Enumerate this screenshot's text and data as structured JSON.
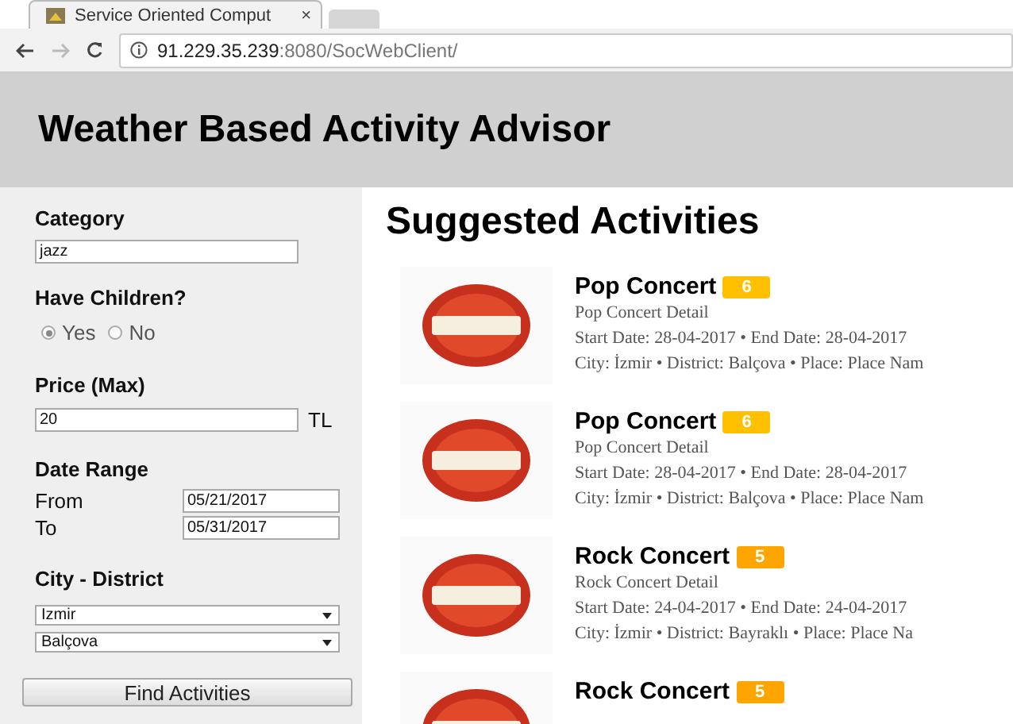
{
  "browser": {
    "tab_title": "Service Oriented Comput",
    "tab_close": "×",
    "url_host": "91.229.35.239",
    "url_rest": ":8080/SocWebClient/"
  },
  "header": {
    "title": "Weather Based Activity Advisor"
  },
  "sidebar": {
    "category_label": "Category",
    "category_value": "jazz",
    "children_label": "Have Children?",
    "children_options": [
      {
        "label": "Yes",
        "selected": true
      },
      {
        "label": "No",
        "selected": false
      }
    ],
    "price_label": "Price (Max)",
    "price_value": "20",
    "price_unit": "TL",
    "date_label": "Date Range",
    "from_label": "From",
    "from_value": "05/21/2017",
    "to_label": "To",
    "to_value": "05/31/2017",
    "city_label": "City - District",
    "city_value": "Izmir",
    "district_value": "Balçova",
    "button": "Find Activities"
  },
  "main": {
    "title": "Suggested Activities",
    "activities": [
      {
        "title": "Pop Concert",
        "score": "6",
        "color": "#ffc000",
        "detail": "Pop Concert Detail",
        "dates": "Start Date: 28-04-2017 • End Date: 28-04-2017",
        "place": "City: İzmir • District: Balçova • Place: Place Nam"
      },
      {
        "title": "Pop Concert",
        "score": "6",
        "color": "#ffc000",
        "detail": "Pop Concert Detail",
        "dates": "Start Date: 28-04-2017 • End Date: 28-04-2017",
        "place": "City: İzmir • District: Balçova • Place: Place Nam"
      },
      {
        "title": "Rock Concert",
        "score": "5",
        "color": "#ffa500",
        "detail": "Rock Concert Detail",
        "dates": "Start Date: 24-04-2017 • End Date: 24-04-2017",
        "place": "City: İzmir • District: Bayraklı • Place: Place Na"
      },
      {
        "title": "Rock Concert",
        "score": "5",
        "color": "#ffa500"
      }
    ]
  }
}
